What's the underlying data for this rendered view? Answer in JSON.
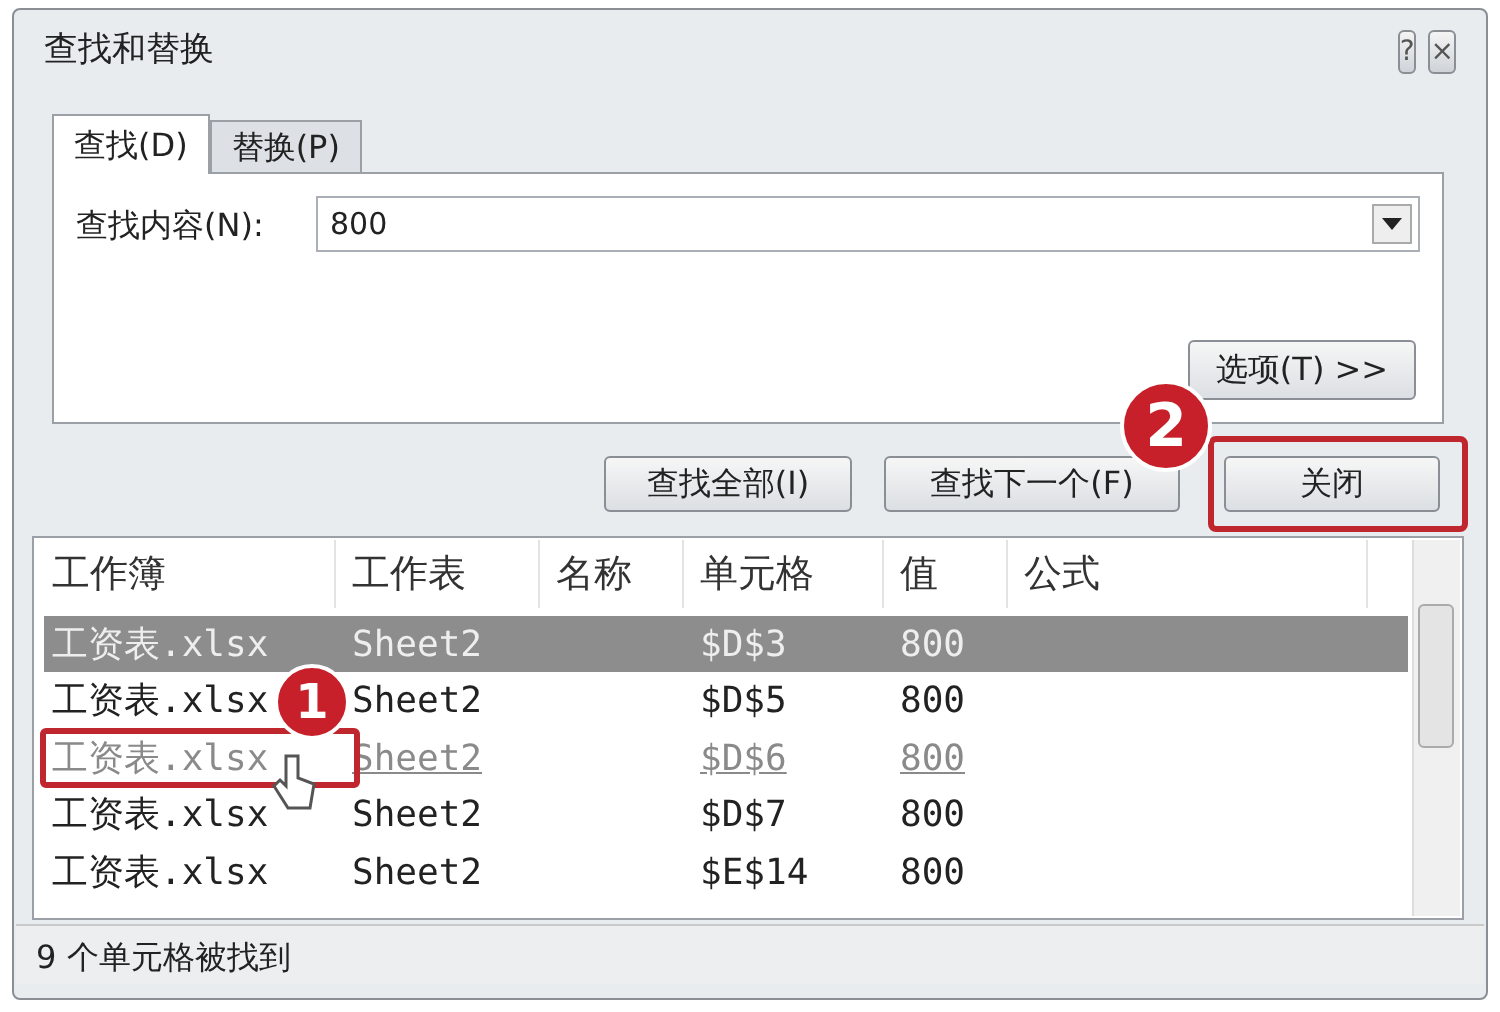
{
  "window": {
    "title": "查找和替换"
  },
  "title_buttons": [
    "?",
    "×"
  ],
  "tabs": [
    {
      "label": "查找(D)",
      "selected": true
    },
    {
      "label": "替换(P)",
      "selected": false
    }
  ],
  "find_field": {
    "label": "查找内容(N):",
    "value": "800"
  },
  "options_button": "选项(T) >>",
  "buttons": [
    {
      "label": "查找全部(I)"
    },
    {
      "label": "查找下一个(F)"
    },
    {
      "label": "关闭"
    }
  ],
  "results": {
    "columns": [
      "工作簿",
      "工作表",
      "名称",
      "单元格",
      "值",
      "公式"
    ],
    "rows": [
      {
        "cells": [
          "工资表.xlsx",
          "Sheet2",
          "",
          "$D$3",
          "800",
          ""
        ],
        "selected": true,
        "hovered": false
      },
      {
        "cells": [
          "工资表.xlsx",
          "Sheet2",
          "",
          "$D$5",
          "800",
          ""
        ],
        "selected": false,
        "hovered": false
      },
      {
        "cells": [
          "工资表.xlsx",
          "Sheet2",
          "",
          "$D$6",
          "800",
          ""
        ],
        "selected": false,
        "hovered": true
      },
      {
        "cells": [
          "工资表.xlsx",
          "Sheet2",
          "",
          "$D$7",
          "800",
          ""
        ],
        "selected": false,
        "hovered": false
      },
      {
        "cells": [
          "工资表.xlsx",
          "Sheet2",
          "",
          "$E$14",
          "800",
          ""
        ],
        "selected": false,
        "hovered": false
      }
    ]
  },
  "status_bar": "9 个单元格被找到",
  "callouts": [
    {
      "label": "1"
    },
    {
      "label": "2"
    }
  ]
}
